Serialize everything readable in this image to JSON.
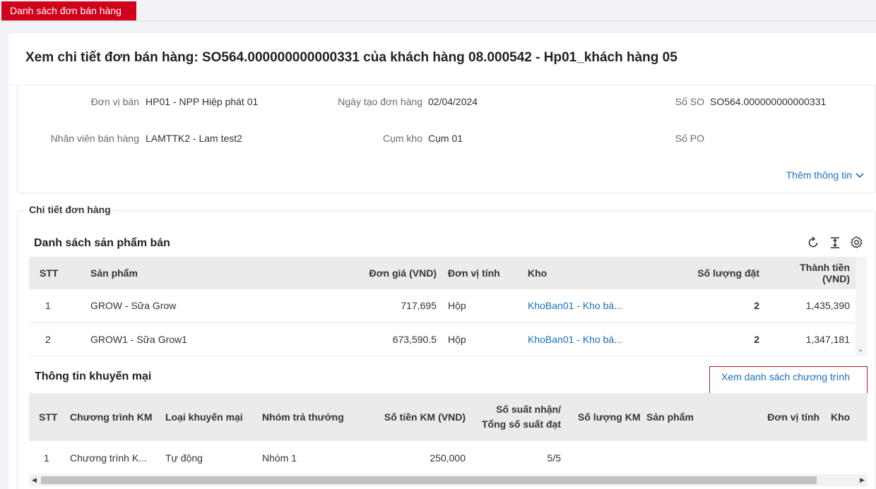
{
  "tab": {
    "label": "Danh sách đơn bán hàng"
  },
  "page": {
    "title": "Xem chi tiết đơn bán hàng: SO564.000000000000331 của khách hàng 08.000542 - Hp01_khách hàng 05"
  },
  "info": {
    "don_vi_ban_label": "Đơn vị bán",
    "don_vi_ban_value": "HP01 - NPP Hiệp phát 01",
    "ngay_tao_label": "Ngày tạo đơn hàng",
    "ngay_tao_value": "02/04/2024",
    "so_so_label": "Số SO",
    "so_so_value": "SO564.000000000000331",
    "nhan_vien_label": "Nhân viên bán hàng",
    "nhan_vien_value": "LAMTTK2 - Lam test2",
    "cum_kho_label": "Cụm kho",
    "cum_kho_value": "Cụm 01",
    "so_po_label": "Số PO",
    "so_po_value": "",
    "more_label": "Thêm thông tin"
  },
  "detail": {
    "legend": "Chi tiết đơn hàng"
  },
  "products": {
    "title": "Danh sách sản phẩm bán",
    "headers": {
      "stt": "STT",
      "san_pham": "Sản phẩm",
      "don_gia": "Đơn giá (VND)",
      "don_vi_tinh": "Đơn vị tính",
      "kho": "Kho",
      "so_luong": "Số lượng đặt",
      "thanh_tien": "Thành tiền (VND)"
    },
    "rows": [
      {
        "stt": "1",
        "san_pham": "GROW - Sữa Grow",
        "don_gia": "717,695",
        "don_vi_tinh": "Hộp",
        "kho": "KhoBan01 - Kho bá...",
        "so_luong": "2",
        "thanh_tien": "1,435,390"
      },
      {
        "stt": "2",
        "san_pham": "GROW1 - Sữa Grow1",
        "don_gia": "673,590.5",
        "don_vi_tinh": "Hộp",
        "kho": "KhoBan01 - Kho bá...",
        "so_luong": "2",
        "thanh_tien": "1,347,181"
      }
    ]
  },
  "promo": {
    "title": "Thông tin khuyến mại",
    "link": "Xem danh sách chương trình",
    "headers": {
      "stt": "STT",
      "chuong_trinh": "Chương trình KM",
      "loai": "Loại khuyến mại",
      "nhom": "Nhóm trả thưởng",
      "so_tien": "Số tiền KM (VND)",
      "so_suat_1": "Số suất nhận/",
      "so_suat_2": "Tổng số suất đạt",
      "so_luong": "Số lượng KM",
      "san_pham": "Sản phẩm",
      "don_vi_tinh": "Đơn vị tính",
      "kho": "Kho"
    },
    "rows": [
      {
        "stt": "1",
        "chuong_trinh": "Chương trình K...",
        "loai": "Tự động",
        "nhom": "Nhóm 1",
        "so_tien": "250,000",
        "so_suat": "5/5",
        "so_luong": "",
        "san_pham": "",
        "don_vi_tinh": "",
        "kho": ""
      }
    ]
  }
}
